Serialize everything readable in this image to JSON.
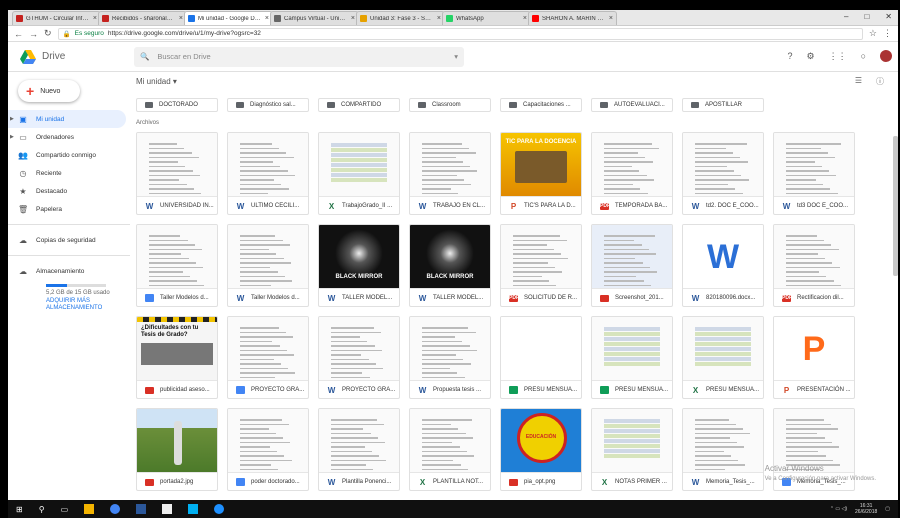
{
  "browser": {
    "tabs": [
      {
        "title": "GTHUM - Circular Informativa",
        "icon_color": "#c5221f"
      },
      {
        "title": "Recibidos - sharonalejand",
        "icon_color": "#c5221f"
      },
      {
        "title": "Mi unidad - Google Drive",
        "icon_color": "#1a73e8",
        "active": true
      },
      {
        "title": "Campus Virtual - Univers",
        "icon_color": "#666666"
      },
      {
        "title": "Unidad 3: Fase 3 - Seleccion",
        "icon_color": "#e6a100"
      },
      {
        "title": "WhatsApp",
        "icon_color": "#25d366"
      },
      {
        "title": "SHARON A. MARIN R. - YouTube",
        "icon_color": "#ff0000"
      }
    ],
    "secure_label": "Es seguro",
    "url": "https://drive.google.com/drive/u/1/my-drive?ogsrc=32",
    "minimize": "–",
    "maximize": "□",
    "close": "✕"
  },
  "header": {
    "app_name": "Drive",
    "search_placeholder": "Buscar en Drive"
  },
  "sidebar": {
    "new_label": "Nuevo",
    "items": [
      {
        "label": "Mi unidad",
        "icon": "drive-icon",
        "active": true
      },
      {
        "label": "Ordenadores",
        "icon": "computer-icon"
      },
      {
        "label": "Compartido conmigo",
        "icon": "people-icon"
      },
      {
        "label": "Reciente",
        "icon": "clock-icon"
      },
      {
        "label": "Destacado",
        "icon": "star-icon"
      },
      {
        "label": "Papelera",
        "icon": "trash-icon"
      }
    ],
    "backups_label": "Copias de seguridad",
    "storage_label": "Almacenamiento",
    "storage_used": "5,2 GB de 15 GB usado",
    "storage_fraction": 0.35,
    "buy_storage": "ADQUIRIR MÁS ALMACENAMIENTO"
  },
  "main": {
    "breadcrumb": "Mi unidad",
    "folders": [
      "DOCTORADO",
      "Diagnóstico sal...",
      "COMPARTIDO",
      "Classroom",
      "Capacitaciones ...",
      "AUTOEVALUACI...",
      "APOSTILLAR"
    ],
    "files_section": "Archivos",
    "files": [
      {
        "name": "UNIVERSIDAD IN...",
        "type": "w",
        "thumb": "doc"
      },
      {
        "name": "ULTIMO CECILI...",
        "type": "w",
        "thumb": "doc"
      },
      {
        "name": "TrabajoGrado_II ...",
        "type": "x",
        "thumb": "sheet"
      },
      {
        "name": "TRABAJO EN CL...",
        "type": "w",
        "thumb": "doc"
      },
      {
        "name": "TIC'S PARA LA D...",
        "type": "p",
        "thumb": "tic",
        "thumb_text": "TIC PARA LA DOCENCIA"
      },
      {
        "name": "TEMPORADA BA...",
        "type": "pdf",
        "thumb": "doc"
      },
      {
        "name": "td2. DOC E_COO...",
        "type": "w",
        "thumb": "doc"
      },
      {
        "name": "td3 DOC E_COO...",
        "type": "w",
        "thumb": "doc"
      },
      {
        "name": "Taller Modelos d...",
        "type": "doc",
        "thumb": "doc"
      },
      {
        "name": "Taller Modelos d...",
        "type": "w",
        "thumb": "doc"
      },
      {
        "name": "TALLER MODEL...",
        "type": "w",
        "thumb": "dark",
        "thumb_text": "BLACK MIRROR"
      },
      {
        "name": "TALLER MODEL...",
        "type": "w",
        "thumb": "dark",
        "thumb_text": "BLACK MIRROR"
      },
      {
        "name": "SOLICITUD DE R...",
        "type": "pdf",
        "thumb": "form"
      },
      {
        "name": "Screenshot_201...",
        "type": "img",
        "thumb": "screen"
      },
      {
        "name": "820180096.docx...",
        "type": "w",
        "thumb": "wlogo",
        "thumb_text": "W"
      },
      {
        "name": "Rectificacion dil...",
        "type": "pdf",
        "thumb": "doc"
      },
      {
        "name": "publicidad aseso...",
        "type": "img",
        "thumb": "poster",
        "thumb_text": "¿Dificultades con tu Tesis de Grado?"
      },
      {
        "name": "PROYECTO GRA...",
        "type": "doc",
        "thumb": "doc"
      },
      {
        "name": "PROYECTO GRA...",
        "type": "w",
        "thumb": "doc"
      },
      {
        "name": "Propuesta tesis ...",
        "type": "w",
        "thumb": "doc"
      },
      {
        "name": "PRESU MENSUA...",
        "type": "sh",
        "thumb": "blank"
      },
      {
        "name": "PRESU MENSUA...",
        "type": "sh",
        "thumb": "sheet"
      },
      {
        "name": "PRESU MENSUA...",
        "type": "x",
        "thumb": "sheet"
      },
      {
        "name": "PRESENTACIÓN ...",
        "type": "p",
        "thumb": "plogo",
        "thumb_text": "P"
      },
      {
        "name": "portada2.jpg",
        "type": "img",
        "thumb": "photo"
      },
      {
        "name": "poder doctorado...",
        "type": "doc",
        "thumb": "doc"
      },
      {
        "name": "Plantilla Ponenci...",
        "type": "w",
        "thumb": "doc"
      },
      {
        "name": "PLANTILLA NOT...",
        "type": "x",
        "thumb": "doc"
      },
      {
        "name": "pia_opt.png",
        "type": "img",
        "thumb": "badge",
        "thumb_text": "EDUCACIÓN"
      },
      {
        "name": "NOTAS PRIMER ...",
        "type": "x",
        "thumb": "sheet"
      },
      {
        "name": "Memoria_Tesis_...",
        "type": "w",
        "thumb": "doc"
      },
      {
        "name": "Memoria_Tesis_...",
        "type": "doc",
        "thumb": "doc"
      }
    ]
  },
  "watermark": {
    "title": "Activar Windows",
    "subtitle": "Ve a Configuración para activar Windows."
  },
  "taskbar": {
    "time": "16:31",
    "date": "26/6/2018"
  }
}
